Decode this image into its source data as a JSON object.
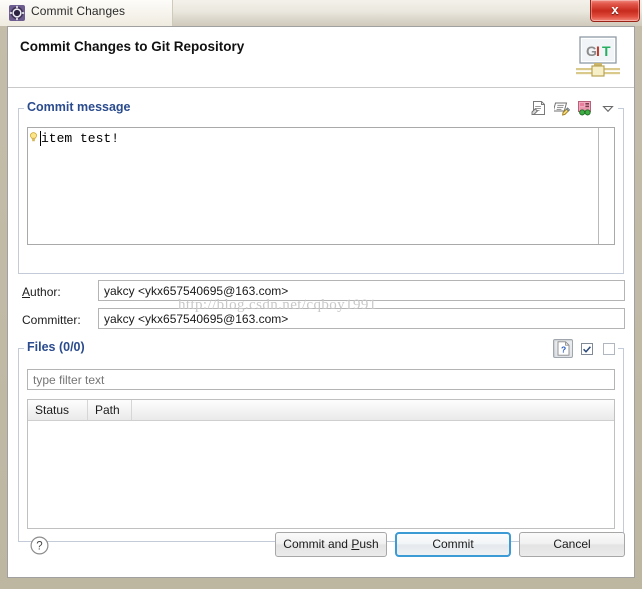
{
  "window": {
    "title": "Commit Changes",
    "icon": "app-gear-icon",
    "close_label": "x"
  },
  "header": {
    "title": "Commit Changes to Git Repository",
    "logo_letters": [
      "G",
      "I",
      "T"
    ],
    "logo_colors": [
      "#8c8c8c",
      "#c0392b",
      "#27ae60"
    ]
  },
  "commit_message": {
    "group_label": "Commit message",
    "text": "item test!",
    "tools": [
      {
        "name": "amend-previous-commit-icon",
        "title": "Amend previous commit"
      },
      {
        "name": "add-signed-off-by-icon",
        "title": "Add Signed-off-by"
      },
      {
        "name": "add-change-id-icon",
        "title": "Add Change-Id"
      },
      {
        "name": "chevron-down-icon",
        "title": "Menu"
      }
    ]
  },
  "fields": [
    {
      "id": "author",
      "label_pre": "A",
      "label_post": "uthor:",
      "value": "yakcy <ykx657540695@163.com>",
      "mnemonic": true
    },
    {
      "id": "committer",
      "label_pre": "",
      "label_post": "Committer:",
      "value": "yakcy <ykx657540695@163.com>",
      "mnemonic": false
    }
  ],
  "files": {
    "group_label": "Files (0/0)",
    "filter_placeholder": "type filter text",
    "filter_value": "",
    "tools": [
      {
        "name": "show-untracked-files-icon",
        "title": "Show untracked files",
        "pressed": true
      },
      {
        "name": "select-all-icon",
        "title": "Select all",
        "pressed": false
      },
      {
        "name": "deselect-all-icon",
        "title": "Deselect all",
        "pressed": false
      }
    ],
    "columns": [
      "Status",
      "Path"
    ],
    "rows": []
  },
  "footer": {
    "help_icon": "help-question-icon",
    "buttons": [
      {
        "id": "commit-and-push",
        "pre": "Commit and ",
        "mn": "P",
        "post": "ush",
        "default": false
      },
      {
        "id": "commit",
        "pre": "Commit",
        "mn": "",
        "post": "",
        "default": true
      },
      {
        "id": "cancel",
        "pre": "Cancel",
        "mn": "",
        "post": "",
        "default": false
      }
    ]
  },
  "watermark": {
    "text": "http://blog.csdn.net/cqboy1991"
  },
  "colors": {
    "group_label": "#2a4b8d",
    "default_button_border": "#3c9ad4",
    "close_button": "#c62a1c"
  }
}
